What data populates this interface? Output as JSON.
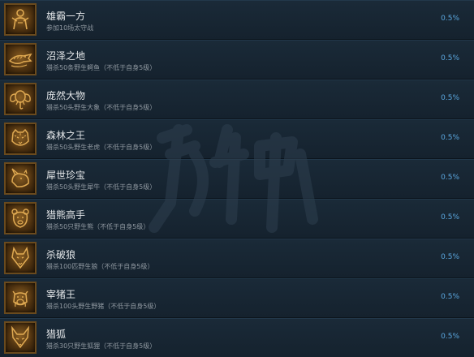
{
  "achievements": [
    {
      "title": "雄霸一方",
      "desc": "参加10场太守战",
      "percent": "0.5%",
      "icon": "warrior-figure-icon"
    },
    {
      "title": "沼泽之地",
      "desc": "猎杀50条野生鳄鱼（不低于自身5级）",
      "percent": "0.5%",
      "icon": "crocodile-icon"
    },
    {
      "title": "庞然大物",
      "desc": "猎杀50头野生大象（不低于自身5级）",
      "percent": "0.5%",
      "icon": "elephant-icon"
    },
    {
      "title": "森林之王",
      "desc": "猎杀50头野生老虎（不低于自身5级）",
      "percent": "0.5%",
      "icon": "tiger-icon"
    },
    {
      "title": "犀世珍宝",
      "desc": "猎杀50头野生犀牛（不低于自身5级）",
      "percent": "0.5%",
      "icon": "rhino-icon"
    },
    {
      "title": "猎熊高手",
      "desc": "猎杀50只野生熊（不低于自身5级）",
      "percent": "0.5%",
      "icon": "bear-icon"
    },
    {
      "title": "杀破狼",
      "desc": "猎杀100匹野生狼（不低于自身5级）",
      "percent": "0.5%",
      "icon": "wolf-icon"
    },
    {
      "title": "宰猪王",
      "desc": "猎杀100头野生野猪（不低于自身5级）",
      "percent": "0.5%",
      "icon": "boar-icon"
    },
    {
      "title": "猎狐",
      "desc": "猎杀30只野生狐狸（不低于自身5级）",
      "percent": "0.5%",
      "icon": "fox-icon"
    }
  ],
  "colors": {
    "title": "#e3e6e8",
    "desc": "#8f98a0",
    "percent": "#5ba8e0",
    "icon_gold": "#d9a24a"
  }
}
